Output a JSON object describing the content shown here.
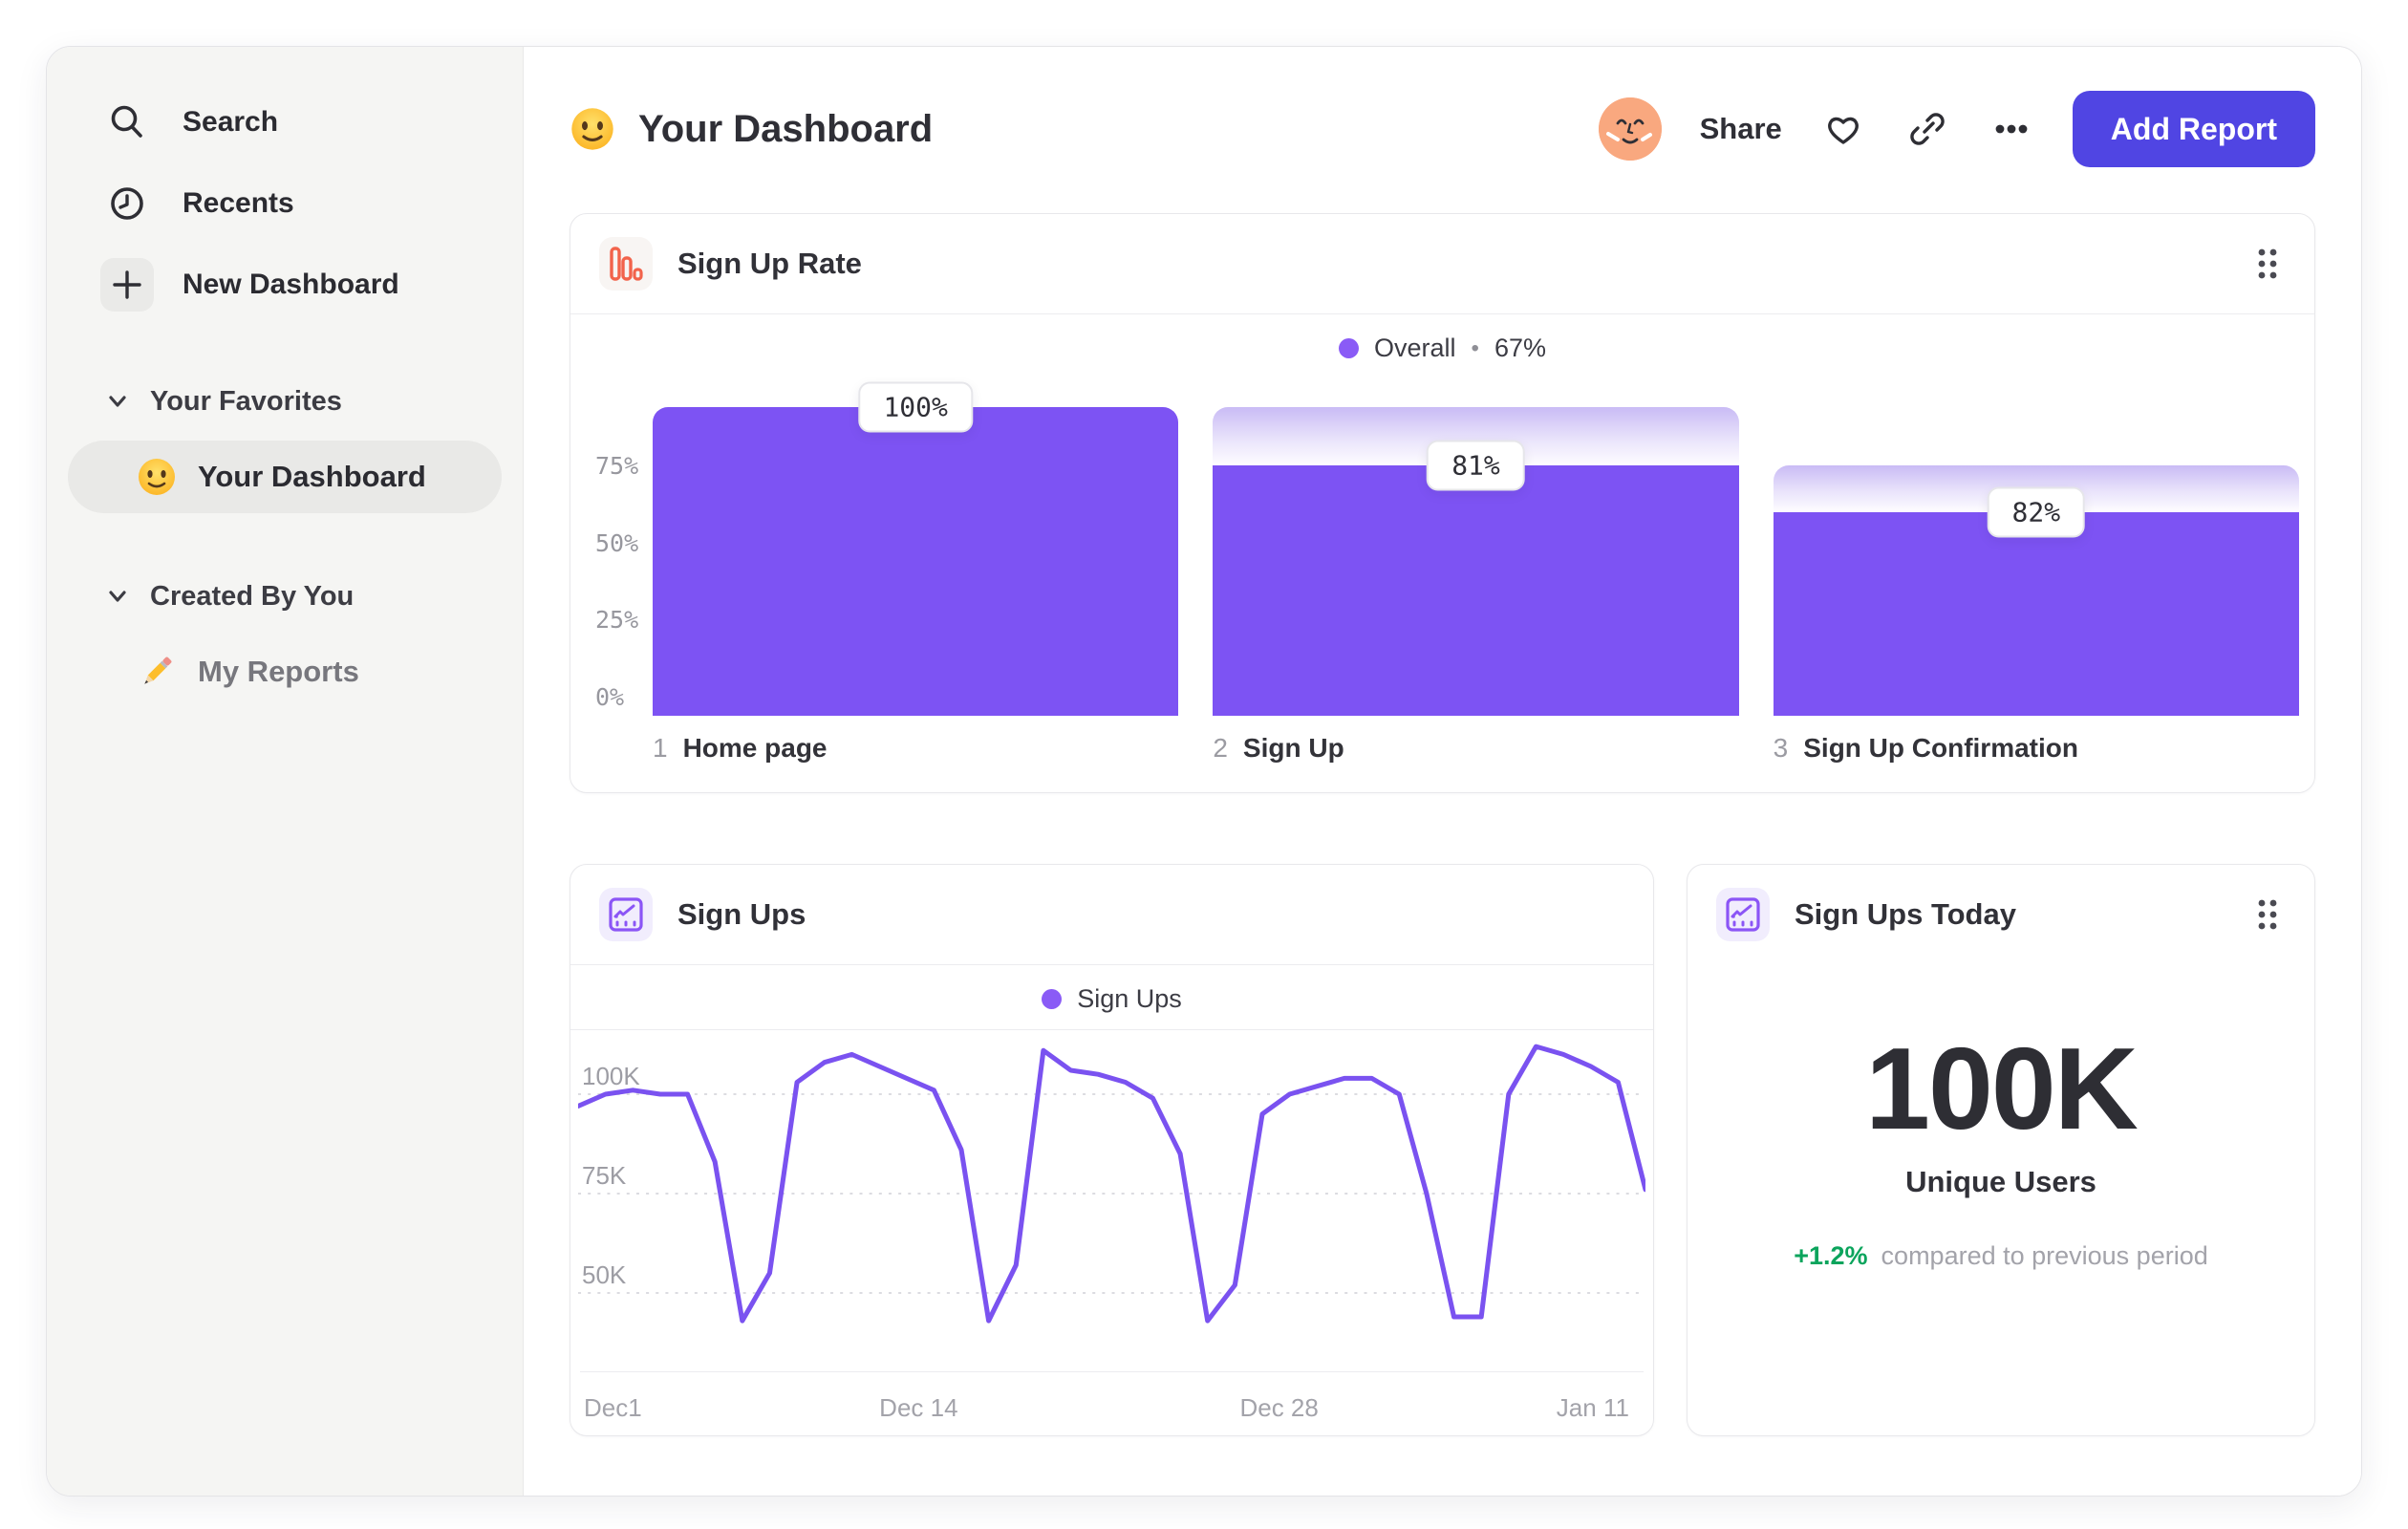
{
  "app": {
    "title": "Your Dashboard"
  },
  "sidebar": {
    "items": [
      {
        "label": "Search",
        "icon": "search-icon"
      },
      {
        "label": "Recents",
        "icon": "clock-icon"
      },
      {
        "label": "New Dashboard",
        "icon": "plus-icon"
      }
    ],
    "sections": [
      {
        "header": "Your Favorites",
        "items": [
          {
            "label": "Your Dashboard",
            "icon": "smiley-emoji",
            "selected": true
          }
        ]
      },
      {
        "header": "Created By You",
        "items": [
          {
            "label": "My Reports",
            "icon": "pencil-emoji",
            "selected": false
          }
        ]
      }
    ]
  },
  "header": {
    "share_label": "Share",
    "add_report_label": "Add Report"
  },
  "cards": {
    "funnel": {
      "title": "Sign Up Rate",
      "legend": {
        "name": "Overall",
        "sep": "•",
        "value": "67%"
      }
    },
    "line": {
      "title": "Sign Ups",
      "legend_label": "Sign Ups"
    },
    "today": {
      "title": "Sign Ups Today",
      "value": "100K",
      "value_label": "Unique Users",
      "delta": "+1.2%",
      "delta_text": "compared to previous period"
    }
  },
  "chart_data": [
    {
      "type": "bar",
      "subtype": "funnel",
      "title": "Sign Up Rate",
      "overall": {
        "name": "Overall",
        "value": "67%"
      },
      "ylim": [
        0,
        100
      ],
      "yticks": [
        {
          "label": "75%",
          "value": 75
        },
        {
          "label": "50%",
          "value": 50
        },
        {
          "label": "25%",
          "value": 25
        },
        {
          "label": "0%",
          "value": 0
        }
      ],
      "steps": [
        {
          "index": "1",
          "label": "Home page",
          "conversion": "100%",
          "cumulative": 100,
          "prev": 100
        },
        {
          "index": "2",
          "label": "Sign Up",
          "conversion": "81%",
          "cumulative": 81,
          "prev": 100
        },
        {
          "index": "3",
          "label": "Sign Up Confirmation",
          "conversion": "82%",
          "cumulative": 66,
          "prev": 81
        }
      ],
      "bar_color": "#7D53F3",
      "grid": false
    },
    {
      "type": "line",
      "title": "Sign Ups",
      "x_range_days": 41,
      "yticks": [
        {
          "label": "100K",
          "value": 100
        },
        {
          "label": "75K",
          "value": 75
        },
        {
          "label": "50K",
          "value": 50
        }
      ],
      "xticks": [
        {
          "label": "Dec1",
          "day": 0
        },
        {
          "label": "Dec 14",
          "day": 13
        },
        {
          "label": "Dec 28",
          "day": 27
        },
        {
          "label": "Jan 11",
          "day": 41
        }
      ],
      "series": [
        {
          "name": "Sign Ups",
          "values": [
            97,
            100,
            101,
            100,
            100,
            83,
            43,
            55,
            103,
            108,
            110,
            107,
            104,
            101,
            86,
            43,
            57,
            111,
            106,
            105,
            103,
            99,
            85,
            43,
            52,
            95,
            100,
            102,
            104,
            104,
            100,
            75,
            44,
            44,
            100,
            112,
            110,
            107,
            103,
            76
          ]
        }
      ],
      "line_color": "#7A52F0",
      "grid": "dotted-horizontal",
      "legend_position": "top-center"
    }
  ],
  "colors": {
    "accent_purple": "#7D53F3",
    "button_indigo": "#5045E3",
    "coral_icon": "#F2634B",
    "green_positive": "#0BA45C"
  }
}
